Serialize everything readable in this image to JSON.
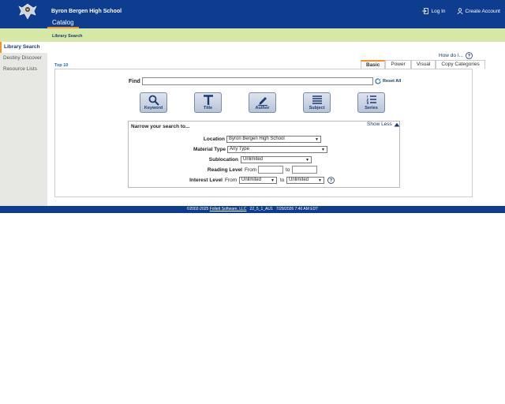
{
  "header": {
    "school_name": "Byron Bergen High School",
    "catalog_tab": "Catalog",
    "login": "Log In",
    "create_account": "Create Account"
  },
  "subbar": {
    "label": "Library Search"
  },
  "sidebar": {
    "items": [
      {
        "label": "Library Search",
        "active": true
      },
      {
        "label": "Destiny Discover",
        "active": false
      },
      {
        "label": "Resource Lists",
        "active": false
      }
    ]
  },
  "main": {
    "how_do_i": "How do I...",
    "top10": "Top 10",
    "modes": [
      "Basic",
      "Power",
      "Visual",
      "Copy Categories"
    ],
    "active_mode": "Basic",
    "find_label": "Find",
    "find_value": "",
    "reset_all": "Reset All",
    "search_buttons": [
      "Keyword",
      "Title",
      "Author",
      "Subject",
      "Series"
    ]
  },
  "narrow": {
    "title": "Narrow your search to...",
    "show_less": "Show Less",
    "location_label": "Location",
    "location_value": "Byron Bergen High School",
    "material_label": "Material Type",
    "material_value": "Any Type",
    "sublocation_label": "Sublocation",
    "sublocation_value": "Unlimited",
    "reading_label": "Reading Level",
    "from_text": "From",
    "to_text": "to",
    "reading_from": "",
    "reading_to": "",
    "interest_label": "Interest Level",
    "interest_from": "Unlimited",
    "interest_to": "Unlimited"
  },
  "footer": {
    "copyright": "©2002-2025",
    "company": "Follett Software, LLC",
    "version": "22_5_1_AU1",
    "timestamp": "7/29/2026 7:40 AM EDT"
  },
  "colors": {
    "header_blue": "#0e3c8e",
    "accent_orange": "#f0932c",
    "subbar_green": "#d6e8a6",
    "link_blue": "#1d3a70"
  }
}
